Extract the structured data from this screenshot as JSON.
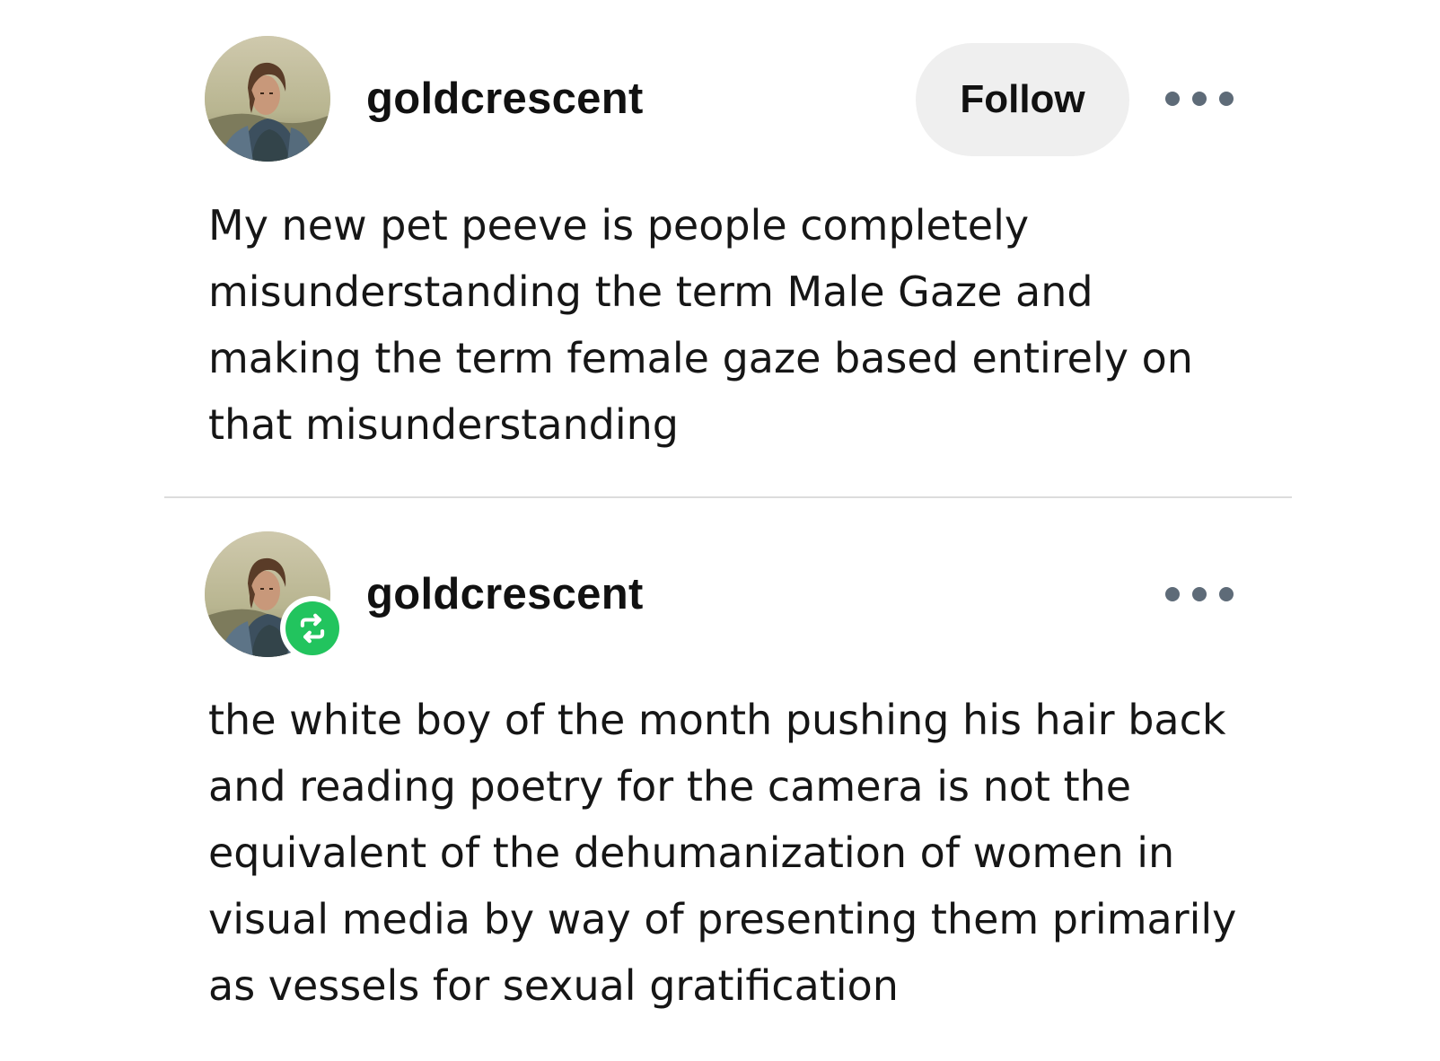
{
  "colors": {
    "follow_bg": "#efefef",
    "dots": "#5e6b78",
    "divider": "#dcdcdc",
    "reblog_green": "#22c45e"
  },
  "posts": [
    {
      "username": "goldcrescent",
      "avatar": "avatar-image",
      "follow_label": "Follow",
      "more_icon": "more-dots-icon",
      "body": "My new pet peeve is people completely misunderstanding the term Male Gaze and making the term female gaze based entirely on that misunderstanding"
    },
    {
      "username": "goldcrescent",
      "avatar": "avatar-image",
      "badge_icon": "reblog-icon",
      "more_icon": "more-dots-icon",
      "body": "the white boy of the month pushing his hair back and reading poetry for the camera is not the equivalent of the dehumanization of women in visual media by way of presenting them primarily as vessels for sexual gratification"
    }
  ]
}
